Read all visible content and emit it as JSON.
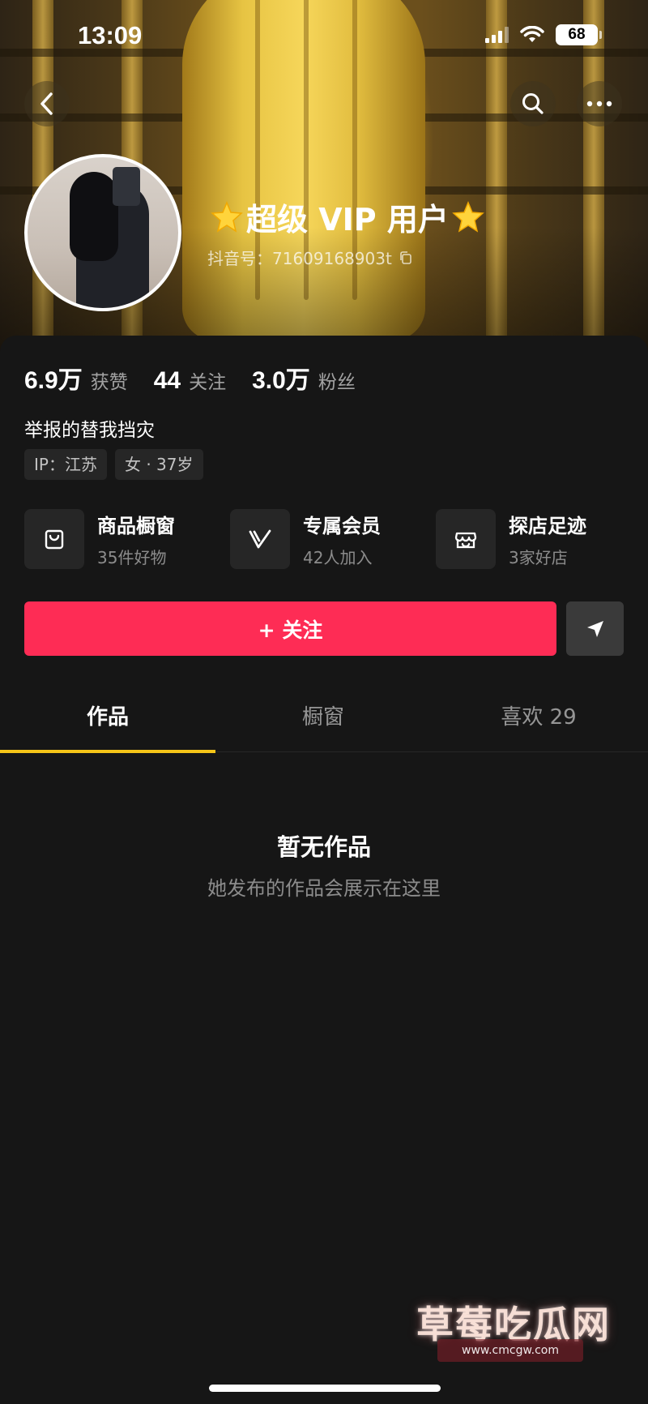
{
  "status_bar": {
    "time": "13:09",
    "battery": "68"
  },
  "profile": {
    "username": "超级 VIP 用户",
    "douyin_id": "抖音号：71609168903t"
  },
  "stats": [
    {
      "value": "6.9万",
      "label": "获赞"
    },
    {
      "value": "44",
      "label": "关注"
    },
    {
      "value": "3.0万",
      "label": "粉丝"
    }
  ],
  "bio": "举报的替我挡灾",
  "tags": [
    "IP：江苏",
    "女 · 37岁"
  ],
  "features": [
    {
      "title": "商品橱窗",
      "sub": "35件好物",
      "icon": "shopping-bag-icon"
    },
    {
      "title": "专属会员",
      "sub": "42人加入",
      "icon": "vip-v-icon"
    },
    {
      "title": "探店足迹",
      "sub": "3家好店",
      "icon": "store-icon"
    }
  ],
  "actions": {
    "follow_label": "+ 关注"
  },
  "tabs": [
    {
      "label": "作品",
      "active": true
    },
    {
      "label": "橱窗",
      "active": false
    },
    {
      "label": "喜欢 29",
      "active": false
    }
  ],
  "empty_state": {
    "title": "暂无作品",
    "subtitle": "她发布的作品会展示在这里"
  },
  "watermark": {
    "text": "草莓吃瓜网",
    "url": "www.cmcgw.com"
  },
  "colors": {
    "follow": "#fe2c55",
    "tab_indicator": "#f5c518",
    "background": "#161616"
  }
}
